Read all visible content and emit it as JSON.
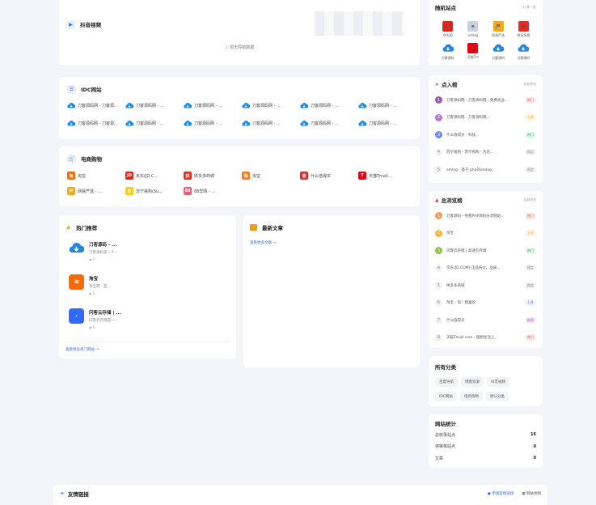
{
  "douyin": {
    "title": "抖音视频",
    "empty": "暂无导航数据"
  },
  "idc": {
    "title": "IDC网站",
    "items": [
      "刀客源码网 - 刀客源码...",
      "刀客源码网 - ...",
      "刀客源码网 - ...",
      "刀客源码网 - ...",
      "刀客源码网 - ...",
      "刀客源码网 - ...",
      "刀客源码网 - 刀客源码...",
      "刀客源码网 - ...",
      "刀客源码网 - ...",
      "刀客源码网 - ...",
      "刀客源码网 - ...",
      "刀客源码网 - ..."
    ]
  },
  "shop": {
    "title": "电商购物",
    "items": [
      {
        "name": "淘宝",
        "icon": "淘",
        "color": "#ff6a00"
      },
      {
        "name": "京东(JD.C...",
        "icon": "JD",
        "color": "#e1251b"
      },
      {
        "name": "拼多多商城",
        "icon": "拼",
        "color": "#e02e24"
      },
      {
        "name": "淘宝",
        "icon": "淘",
        "color": "#ff7a1a"
      },
      {
        "name": "什么值得买",
        "icon": "值",
        "color": "#e62828"
      },
      {
        "name": "天猫Tmall...",
        "icon": "T",
        "color": "#e60012"
      },
      {
        "name": "网易严选 - ...",
        "icon": "严",
        "color": "#f5a623"
      },
      {
        "name": "苏宁易购(Su...",
        "icon": "苏",
        "color": "#ffcc00"
      },
      {
        "name": "88异购 - ...",
        "icon": "88",
        "color": "#f05b72"
      }
    ]
  },
  "hot": {
    "title": "热门推荐",
    "items": [
      {
        "title": "刀客源码 - ...",
        "desc": "刀客源码是一个...",
        "views": "0",
        "icon": "cloud",
        "color": "#1e88e5"
      },
      {
        "title": "淘宝",
        "desc": "淘宝网 - 亚...",
        "views": "0",
        "icon": "淘",
        "color": "#ff6a00"
      },
      {
        "title": "闪客云存储 | ...",
        "desc": "闪客云存储是一...",
        "views": "0",
        "icon": "⚡",
        "color": "#2f6bff"
      }
    ],
    "more": "查看更多热门网站 →"
  },
  "latest": {
    "title": "最新文章",
    "more": "查看更多文章 →"
  },
  "random": {
    "title": "随机站点",
    "refresh": "换一批",
    "items": [
      {
        "name": "京东JD",
        "icon": "JD",
        "color": "#e1251b"
      },
      {
        "name": "emlog",
        "icon": "e",
        "color": "#c9d3e0"
      },
      {
        "name": "网易严选",
        "icon": "严",
        "color": "#f5a623"
      },
      {
        "name": "拼多多商",
        "icon": "拼",
        "color": "#e02e24"
      },
      {
        "name": "刀客源码",
        "icon": "cloud",
        "color": "#1e88e5"
      },
      {
        "name": "天猫Tm",
        "icon": "T",
        "color": "#e60012"
      },
      {
        "name": "刀客源码",
        "icon": "cloud",
        "color": "#1e88e5"
      },
      {
        "name": "刀客源码",
        "icon": "cloud",
        "color": "#1e88e5"
      }
    ]
  },
  "clicks": {
    "title": "点入榜",
    "more": "全部排名",
    "items": [
      {
        "n": "1",
        "text": "刀客源码网 - 刀客源码网 - 免费商业...",
        "badge": "热门",
        "nc": "#9b59b6",
        "bc": "#fdeaea",
        "bt": "#e74c3c"
      },
      {
        "n": "2",
        "text": "刀客源码网 - 刀客源码网...",
        "badge": "上升",
        "nc": "#b07cd8",
        "bc": "#fff3e0",
        "bt": "#f39c12"
      },
      {
        "n": "3",
        "text": "什么值得买 - 科技...",
        "badge": "热门",
        "nc": "#6c8ce8",
        "bc": "#e8f8ee",
        "bt": "#27ae60"
      },
      {
        "n": "4",
        "text": "苏宁易购 - 苏宁易购 - 为您...",
        "badge": "稳定",
        "nc": "#d8d8d8",
        "bc": "#f2f3f5",
        "bt": "#888"
      },
      {
        "n": "5",
        "text": "emlog - 基于 php的emlog...",
        "badge": "稳定",
        "nc": "#d8d8d8",
        "bc": "#f2f3f5",
        "bt": "#888"
      }
    ]
  },
  "total": {
    "title": "总浏览榜",
    "more": "全部排名",
    "items": [
      {
        "n": "1",
        "text": "刀客源码 - 免费PHP源码分享网站...",
        "badge": "热门",
        "nc": "#f39c5a",
        "bc": "#fdeaea",
        "bt": "#e74c3c"
      },
      {
        "n": "2",
        "text": "淘宝",
        "badge": "上升",
        "nc": "#f5b642",
        "bc": "#fff3e0",
        "bt": "#f39c12"
      },
      {
        "n": "3",
        "text": "闪客云存储 | 高速云存储",
        "badge": "热门",
        "nc": "#8bc34a",
        "bc": "#e8f8ee",
        "bt": "#27ae60"
      },
      {
        "n": "4",
        "text": "京东(JD.COM)-正品低价、品质...",
        "badge": "稳定",
        "nc": "#d8d8d8",
        "bc": "#f2f3f5",
        "bt": "#888"
      },
      {
        "n": "5",
        "text": "拼多多商城",
        "badge": "稳定",
        "nc": "#d8d8d8",
        "bc": "#f2f3f5",
        "bt": "#888"
      },
      {
        "n": "6",
        "text": "淘宝 - 淘！我喜欢",
        "badge": "上升",
        "nc": "#d8d8d8",
        "bc": "#eef3ff",
        "bt": "#2f6bff"
      },
      {
        "n": "7",
        "text": "什么值得买",
        "badge": "推荐",
        "nc": "#d8d8d8",
        "bc": "#f5ecff",
        "bt": "#9b59b6"
      },
      {
        "n": "8",
        "text": "天猫Tmall.com - 理想生活上...",
        "badge": "热门",
        "nc": "#d8d8d8",
        "bc": "#fdeaea",
        "bt": "#e74c3c"
      }
    ]
  },
  "cats": {
    "title": "所有分类",
    "items": [
      "百度导航",
      "博客资源",
      "抖音视频",
      "IDC网站",
      "电商购物",
      "默认分类"
    ]
  },
  "stats": {
    "title": "网站统计",
    "rows": [
      {
        "label": "总收录站点",
        "value": "16"
      },
      {
        "label": "待审核站点",
        "value": "0"
      },
      {
        "label": "文章",
        "value": "0"
      }
    ]
  },
  "footer": {
    "title": "友情链接",
    "apply": "申请友情链接",
    "sitemap": "网站地图"
  }
}
